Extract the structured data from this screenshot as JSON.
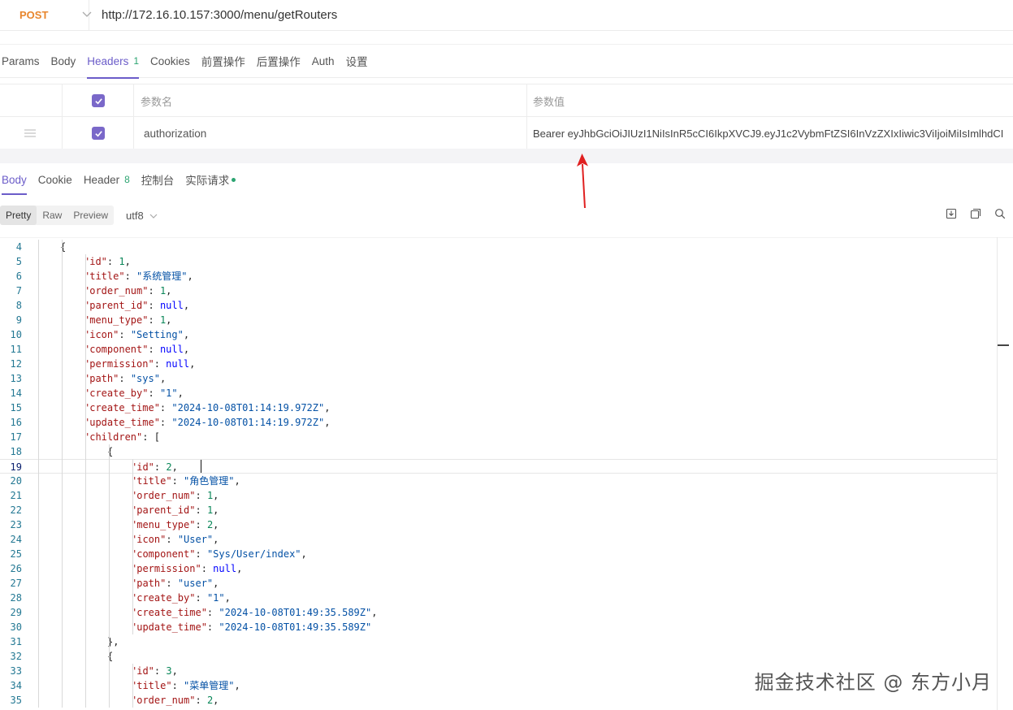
{
  "request": {
    "method": "POST",
    "url": "http://172.16.10.157:3000/menu/getRouters"
  },
  "request_tabs": [
    {
      "label": "Params"
    },
    {
      "label": "Body"
    },
    {
      "label": "Headers",
      "count": "1",
      "active": true
    },
    {
      "label": "Cookies"
    },
    {
      "label": "前置操作"
    },
    {
      "label": "后置操作"
    },
    {
      "label": "Auth"
    },
    {
      "label": "设置"
    }
  ],
  "headers_table": {
    "col_name": "参数名",
    "col_value": "参数值",
    "rows": [
      {
        "key": "authorization",
        "value": "Bearer eyJhbGciOiJIUzI1NiIsInR5cCI6IkpXVCJ9.eyJ1c2VybmFtZSI6InVzZXIxIiwic3ViIjoiMiIsImlhdCI",
        "enabled": true
      }
    ]
  },
  "response_tabs": [
    {
      "label": "Body",
      "active": true
    },
    {
      "label": "Cookie"
    },
    {
      "label": "Header",
      "count": "8"
    },
    {
      "label": "控制台"
    },
    {
      "label": "实际请求"
    }
  ],
  "view_modes": [
    {
      "label": "Pretty",
      "active": true
    },
    {
      "label": "Raw"
    },
    {
      "label": "Preview"
    }
  ],
  "encoding": "utf8",
  "colors": {
    "accent": "#6b5cc9",
    "method": "#e8862d",
    "count": "#2ba471",
    "arrow": "#e02020"
  },
  "editor": {
    "current_line": 19,
    "lines": [
      {
        "n": 4,
        "depth": 2,
        "parts": [
          [
            "p",
            "{"
          ]
        ]
      },
      {
        "n": 5,
        "depth": 3,
        "parts": [
          [
            "k",
            "\"id\""
          ],
          [
            "p",
            ": "
          ],
          [
            "n",
            "1"
          ],
          [
            "p",
            ","
          ]
        ]
      },
      {
        "n": 6,
        "depth": 3,
        "parts": [
          [
            "k",
            "\"title\""
          ],
          [
            "p",
            ": "
          ],
          [
            "s",
            "\"系统管理\""
          ],
          [
            "p",
            ","
          ]
        ]
      },
      {
        "n": 7,
        "depth": 3,
        "parts": [
          [
            "k",
            "\"order_num\""
          ],
          [
            "p",
            ": "
          ],
          [
            "n",
            "1"
          ],
          [
            "p",
            ","
          ]
        ]
      },
      {
        "n": 8,
        "depth": 3,
        "parts": [
          [
            "k",
            "\"parent_id\""
          ],
          [
            "p",
            ": "
          ],
          [
            "nl",
            "null"
          ],
          [
            "p",
            ","
          ]
        ]
      },
      {
        "n": 9,
        "depth": 3,
        "parts": [
          [
            "k",
            "\"menu_type\""
          ],
          [
            "p",
            ": "
          ],
          [
            "n",
            "1"
          ],
          [
            "p",
            ","
          ]
        ]
      },
      {
        "n": 10,
        "depth": 3,
        "parts": [
          [
            "k",
            "\"icon\""
          ],
          [
            "p",
            ": "
          ],
          [
            "s",
            "\"Setting\""
          ],
          [
            "p",
            ","
          ]
        ]
      },
      {
        "n": 11,
        "depth": 3,
        "parts": [
          [
            "k",
            "\"component\""
          ],
          [
            "p",
            ": "
          ],
          [
            "nl",
            "null"
          ],
          [
            "p",
            ","
          ]
        ]
      },
      {
        "n": 12,
        "depth": 3,
        "parts": [
          [
            "k",
            "\"permission\""
          ],
          [
            "p",
            ": "
          ],
          [
            "nl",
            "null"
          ],
          [
            "p",
            ","
          ]
        ]
      },
      {
        "n": 13,
        "depth": 3,
        "parts": [
          [
            "k",
            "\"path\""
          ],
          [
            "p",
            ": "
          ],
          [
            "s",
            "\"sys\""
          ],
          [
            "p",
            ","
          ]
        ]
      },
      {
        "n": 14,
        "depth": 3,
        "parts": [
          [
            "k",
            "\"create_by\""
          ],
          [
            "p",
            ": "
          ],
          [
            "s",
            "\"1\""
          ],
          [
            "p",
            ","
          ]
        ]
      },
      {
        "n": 15,
        "depth": 3,
        "parts": [
          [
            "k",
            "\"create_time\""
          ],
          [
            "p",
            ": "
          ],
          [
            "s",
            "\"2024-10-08T01:14:19.972Z\""
          ],
          [
            "p",
            ","
          ]
        ]
      },
      {
        "n": 16,
        "depth": 3,
        "parts": [
          [
            "k",
            "\"update_time\""
          ],
          [
            "p",
            ": "
          ],
          [
            "s",
            "\"2024-10-08T01:14:19.972Z\""
          ],
          [
            "p",
            ","
          ]
        ]
      },
      {
        "n": 17,
        "depth": 3,
        "parts": [
          [
            "k",
            "\"children\""
          ],
          [
            "p",
            ": ["
          ]
        ]
      },
      {
        "n": 18,
        "depth": 4,
        "parts": [
          [
            "p",
            "{"
          ]
        ]
      },
      {
        "n": 19,
        "depth": 5,
        "parts": [
          [
            "k",
            "\"id\""
          ],
          [
            "p",
            ": "
          ],
          [
            "n",
            "2"
          ],
          [
            "p",
            ","
          ]
        ]
      },
      {
        "n": 20,
        "depth": 5,
        "parts": [
          [
            "k",
            "\"title\""
          ],
          [
            "p",
            ": "
          ],
          [
            "s",
            "\"角色管理\""
          ],
          [
            "p",
            ","
          ]
        ]
      },
      {
        "n": 21,
        "depth": 5,
        "parts": [
          [
            "k",
            "\"order_num\""
          ],
          [
            "p",
            ": "
          ],
          [
            "n",
            "1"
          ],
          [
            "p",
            ","
          ]
        ]
      },
      {
        "n": 22,
        "depth": 5,
        "parts": [
          [
            "k",
            "\"parent_id\""
          ],
          [
            "p",
            ": "
          ],
          [
            "n",
            "1"
          ],
          [
            "p",
            ","
          ]
        ]
      },
      {
        "n": 23,
        "depth": 5,
        "parts": [
          [
            "k",
            "\"menu_type\""
          ],
          [
            "p",
            ": "
          ],
          [
            "n",
            "2"
          ],
          [
            "p",
            ","
          ]
        ]
      },
      {
        "n": 24,
        "depth": 5,
        "parts": [
          [
            "k",
            "\"icon\""
          ],
          [
            "p",
            ": "
          ],
          [
            "s",
            "\"User\""
          ],
          [
            "p",
            ","
          ]
        ]
      },
      {
        "n": 25,
        "depth": 5,
        "parts": [
          [
            "k",
            "\"component\""
          ],
          [
            "p",
            ": "
          ],
          [
            "s",
            "\"Sys/User/index\""
          ],
          [
            "p",
            ","
          ]
        ]
      },
      {
        "n": 26,
        "depth": 5,
        "parts": [
          [
            "k",
            "\"permission\""
          ],
          [
            "p",
            ": "
          ],
          [
            "nl",
            "null"
          ],
          [
            "p",
            ","
          ]
        ]
      },
      {
        "n": 27,
        "depth": 5,
        "parts": [
          [
            "k",
            "\"path\""
          ],
          [
            "p",
            ": "
          ],
          [
            "s",
            "\"user\""
          ],
          [
            "p",
            ","
          ]
        ]
      },
      {
        "n": 28,
        "depth": 5,
        "parts": [
          [
            "k",
            "\"create_by\""
          ],
          [
            "p",
            ": "
          ],
          [
            "s",
            "\"1\""
          ],
          [
            "p",
            ","
          ]
        ]
      },
      {
        "n": 29,
        "depth": 5,
        "parts": [
          [
            "k",
            "\"create_time\""
          ],
          [
            "p",
            ": "
          ],
          [
            "s",
            "\"2024-10-08T01:49:35.589Z\""
          ],
          [
            "p",
            ","
          ]
        ]
      },
      {
        "n": 30,
        "depth": 5,
        "parts": [
          [
            "k",
            "\"update_time\""
          ],
          [
            "p",
            ": "
          ],
          [
            "s",
            "\"2024-10-08T01:49:35.589Z\""
          ]
        ]
      },
      {
        "n": 31,
        "depth": 4,
        "parts": [
          [
            "p",
            "},"
          ]
        ]
      },
      {
        "n": 32,
        "depth": 4,
        "parts": [
          [
            "p",
            "{"
          ]
        ]
      },
      {
        "n": 33,
        "depth": 5,
        "parts": [
          [
            "k",
            "\"id\""
          ],
          [
            "p",
            ": "
          ],
          [
            "n",
            "3"
          ],
          [
            "p",
            ","
          ]
        ]
      },
      {
        "n": 34,
        "depth": 5,
        "parts": [
          [
            "k",
            "\"title\""
          ],
          [
            "p",
            ": "
          ],
          [
            "s",
            "\"菜单管理\""
          ],
          [
            "p",
            ","
          ]
        ]
      },
      {
        "n": 35,
        "depth": 5,
        "parts": [
          [
            "k",
            "\"order_num\""
          ],
          [
            "p",
            ": "
          ],
          [
            "n",
            "2"
          ],
          [
            "p",
            ","
          ]
        ]
      }
    ]
  },
  "watermark": "掘金技术社区 @ 东方小月"
}
